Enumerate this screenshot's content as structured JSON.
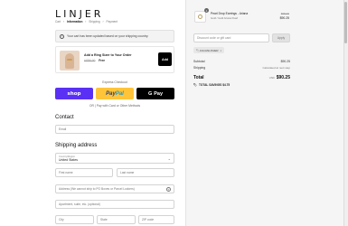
{
  "brand": {
    "logo": "LINJER"
  },
  "breadcrumb": [
    {
      "label": "Cart",
      "current": false
    },
    {
      "label": "›",
      "current": false
    },
    {
      "label": "Information",
      "current": true
    },
    {
      "label": "›",
      "current": false
    },
    {
      "label": "Shipping",
      "current": false
    },
    {
      "label": "›",
      "current": false
    },
    {
      "label": "Payment",
      "current": false
    }
  ],
  "notice": {
    "icon": "info-icon",
    "text": "Your cart has been updated based on your shipping country."
  },
  "upsell": {
    "title": "Add a Ring Sizer to Your Order",
    "old_price": "US$0.00",
    "new_price": "Free",
    "add_label": "Add"
  },
  "express": {
    "heading": "Express Checkout",
    "shop_label": "shop",
    "paypal_a": "Pay",
    "paypal_b": "Pal",
    "gpay_label": "Pay",
    "or_text": "OR | Pay with Card or Other Methods"
  },
  "contact": {
    "heading": "Contact",
    "email_placeholder": "Email"
  },
  "shipping": {
    "heading": "Shipping address",
    "country_label": "Country/Region",
    "country_value": "United States",
    "first_placeholder": "First name",
    "last_placeholder": "Last name",
    "address_placeholder": "Address (We cannot ship to PO Boxes or Parcel Lockers)",
    "apt_placeholder": "Apartment, suite, etc. (optional)",
    "city_placeholder": "City",
    "state_placeholder": "State",
    "zip_placeholder": "ZIP code"
  },
  "cart": {
    "quantity": "1",
    "item_name": "Pearl Drop Earrings - Ariana",
    "item_variant": "Gold / Gold Ariana Pearl",
    "old_price": "$95.00",
    "new_price": "$90.25"
  },
  "discount": {
    "placeholder": "Discount code or gift card",
    "apply_label": "Apply",
    "code": "JULIANLINJER"
  },
  "summary": {
    "subtotal_label": "Subtotal",
    "subtotal_value": "$90.25",
    "shipping_label": "Shipping",
    "shipping_value": "Calculated at next step",
    "total_label": "Total",
    "total_currency": "USD",
    "total_value": "$90.25",
    "savings_text": "TOTAL SAVINGS $4.75"
  },
  "colors": {
    "shop_pay": "#5a31f4",
    "paypal": "#ffc439",
    "gpay": "#000000",
    "sidebar_bg": "#f5f5f5"
  }
}
